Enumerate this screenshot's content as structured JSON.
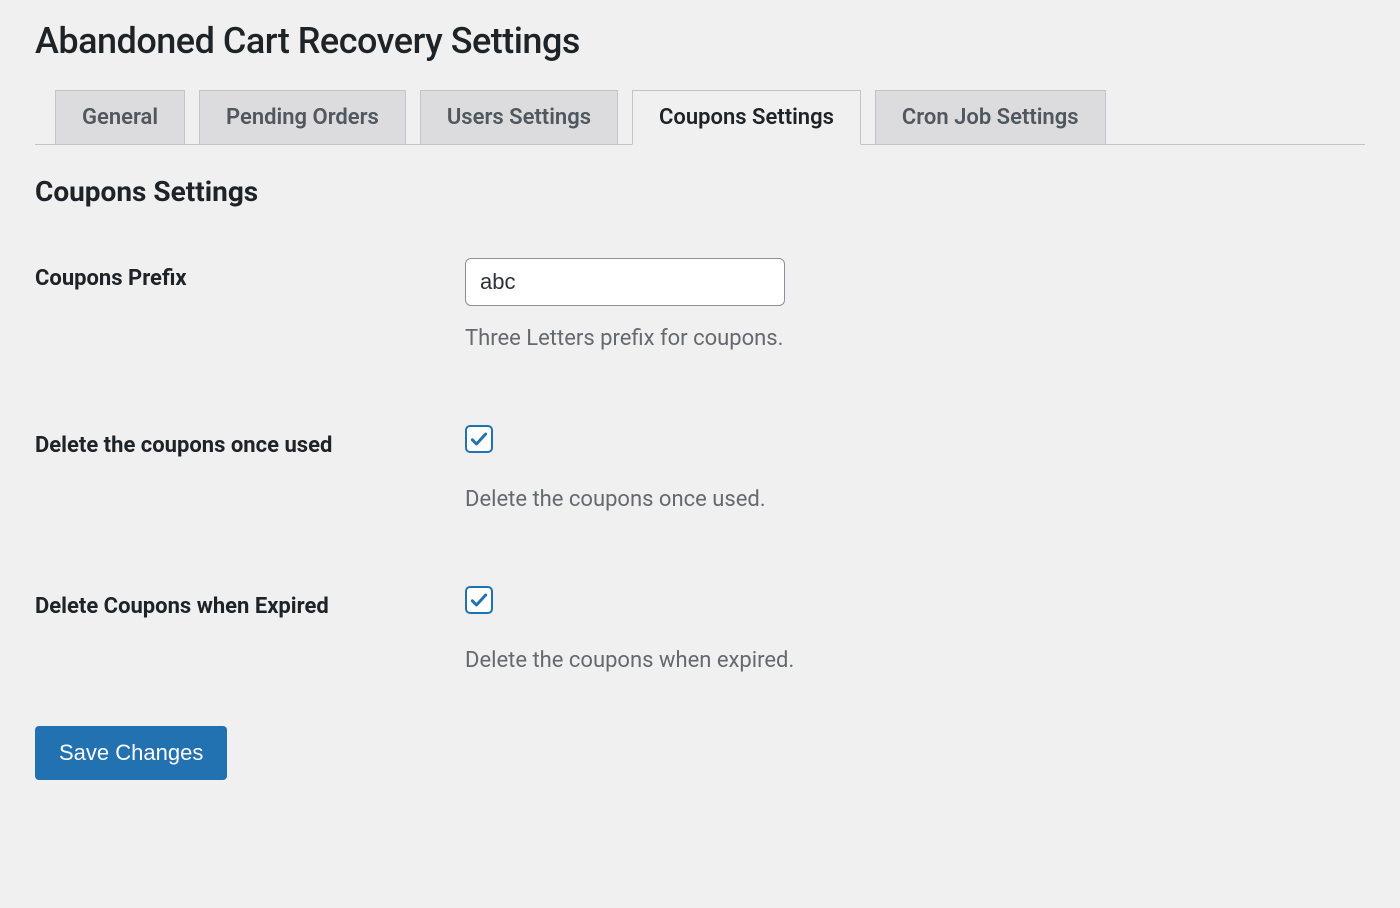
{
  "page_title": "Abandoned Cart Recovery Settings",
  "tabs": [
    {
      "label": "General",
      "active": false
    },
    {
      "label": "Pending Orders",
      "active": false
    },
    {
      "label": "Users Settings",
      "active": false
    },
    {
      "label": "Coupons Settings",
      "active": true
    },
    {
      "label": "Cron Job Settings",
      "active": false
    }
  ],
  "section_heading": "Coupons Settings",
  "fields": {
    "prefix": {
      "label": "Coupons Prefix",
      "value": "abc",
      "help": "Three Letters prefix for coupons."
    },
    "delete_used": {
      "label": "Delete the coupons once used",
      "checked": true,
      "help": "Delete the coupons once used."
    },
    "delete_expired": {
      "label": "Delete Coupons when Expired",
      "checked": true,
      "help": "Delete the coupons when expired."
    }
  },
  "save_label": "Save Changes"
}
